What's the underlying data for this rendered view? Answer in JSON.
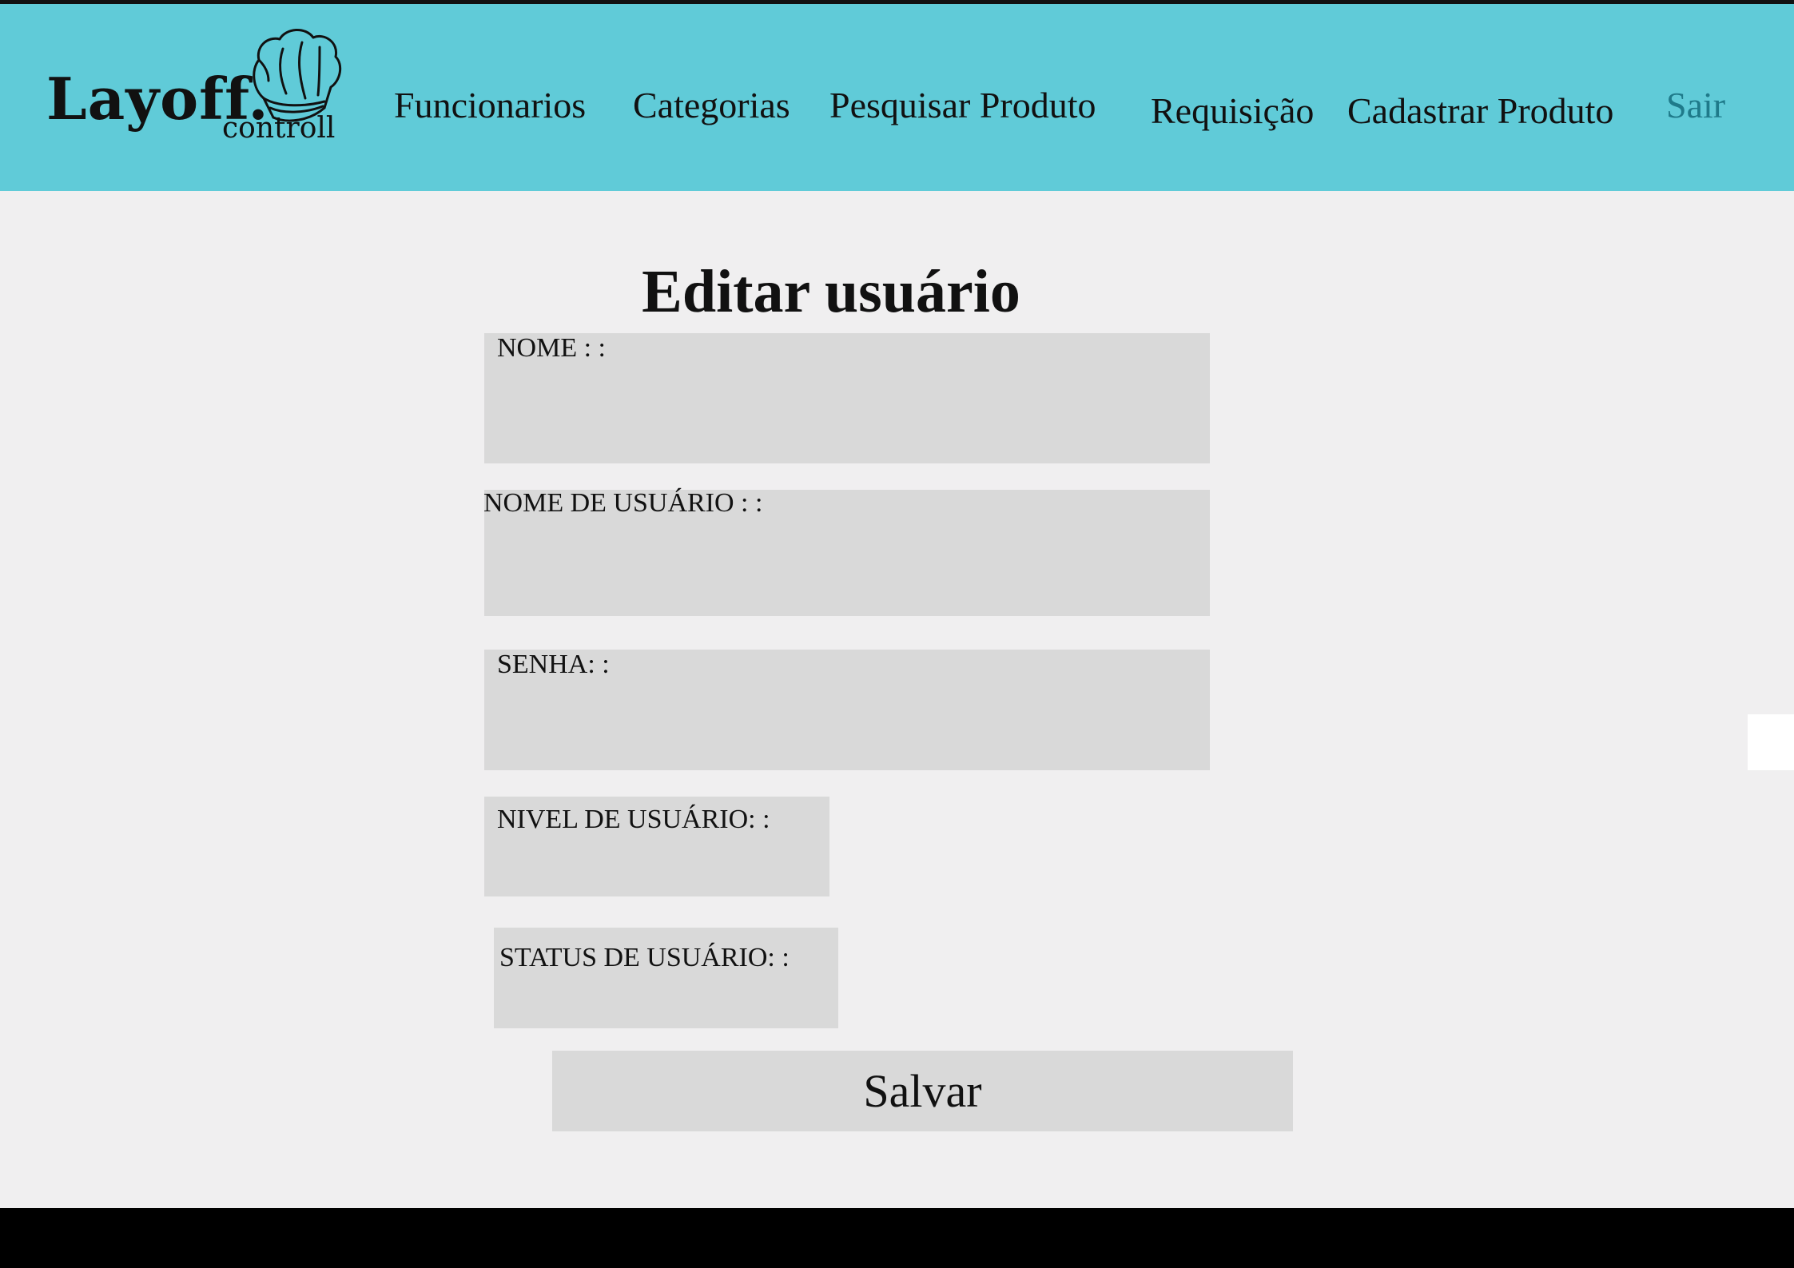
{
  "app": {
    "logo_text": "Layoff.",
    "logo_subtext": "controll"
  },
  "nav": {
    "items": [
      {
        "label": "Funcionarios"
      },
      {
        "label": "Categorias"
      },
      {
        "label": "Pesquisar Produto"
      },
      {
        "label": "Requisição"
      },
      {
        "label": "Cadastrar Produto"
      },
      {
        "label": "Sair"
      }
    ]
  },
  "form": {
    "title": "Editar usuário",
    "fields": [
      {
        "label": "NOME : :",
        "value": ""
      },
      {
        "label": "NOME DE USUÁRIO : :",
        "value": ""
      },
      {
        "label": "SENHA: :",
        "value": ""
      },
      {
        "label": "NIVEL DE USUÁRIO: :",
        "value": ""
      },
      {
        "label": "STATUS DE USUÁRIO: :",
        "value": ""
      }
    ],
    "save_label": "Salvar"
  },
  "colors": {
    "header": "#60cbd8",
    "background": "#f0eff0",
    "field": "#d9d9d9",
    "footer": "#000000",
    "logout_link": "#1f7a8a"
  },
  "icons": {
    "logo_icon": "chef-hat-icon"
  }
}
